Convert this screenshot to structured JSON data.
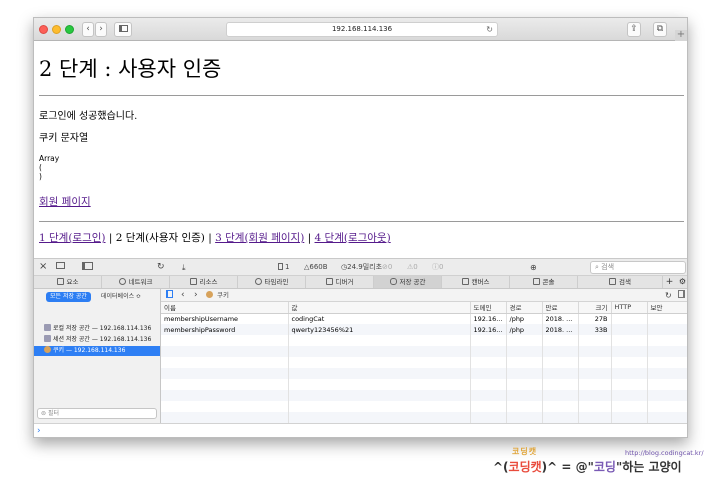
{
  "browser": {
    "url": "192.168.114.136",
    "reload_glyph": "↻",
    "back_glyph": "‹",
    "forward_glyph": "›",
    "share_glyph": "⇪",
    "tabs_glyph": "⧉",
    "new_tab_glyph": "+"
  },
  "page": {
    "title": "2 단계 : 사용자 인증",
    "success_text": "로그인에 성공했습니다.",
    "cookie_label": "쿠키 문자열",
    "array_lines": [
      "Array",
      "(",
      ")"
    ],
    "member_link": "회원 페이지",
    "nav": {
      "step1": "1 단계(로그인)",
      "sep1": " | ",
      "step2": "2 단계(사용자 인증)",
      "sep2": " | ",
      "step3": "3 단계(회원 페이지)",
      "sep3": " | ",
      "step4": "4 단계(로그아웃)"
    }
  },
  "inspector": {
    "close_glyph": "×",
    "toolbar": {
      "reload_glyph": "↻",
      "download_glyph": "⤓",
      "resources_count": "1",
      "size": "660B",
      "time": "24.9밀리초",
      "errors": "0",
      "warnings": "0",
      "logs": "0",
      "search_placeholder": "검색"
    },
    "tabs": [
      {
        "label": "요소"
      },
      {
        "label": "네트워크"
      },
      {
        "label": "리소스"
      },
      {
        "label": "타임라인"
      },
      {
        "label": "디버거"
      },
      {
        "label": "저장 공간",
        "active": true
      },
      {
        "label": "캔버스"
      },
      {
        "label": "콘솔"
      },
      {
        "label": "검색"
      }
    ],
    "sidebar": {
      "scope_button": "모든 저장 공간",
      "db_button": "데이터베이스 ≎",
      "items": [
        {
          "label": "로컬 저장 공간 — 192.168.114.136"
        },
        {
          "label": "세션 저장 공간 — 192.168.114.136"
        },
        {
          "label": "쿠키 — 192.168.114.136",
          "selected": true
        }
      ],
      "filter_placeholder": "필터"
    },
    "path_label": "쿠키",
    "table": {
      "headers": [
        "이름",
        "값",
        "도메인",
        "경로",
        "만료",
        "크기",
        "HTTP",
        "보안"
      ],
      "rows": [
        [
          "membershipUsername",
          "codingCat",
          "192.16...",
          "/php",
          "2018. ...",
          "27B",
          "",
          ""
        ],
        [
          "membershipPassword",
          "qwerty123456%21",
          "192.16...",
          "/php",
          "2018. ...",
          "33B",
          "",
          ""
        ]
      ]
    },
    "console_prompt": "›"
  },
  "watermark": {
    "url": "http://blog.codingcat.kr/",
    "logo": "코딩캣",
    "text_a": "^(",
    "text_b": "코딩캣",
    "text_c": ")^ = @\"",
    "text_d": "코딩",
    "text_e": "\"하는 고양이"
  }
}
